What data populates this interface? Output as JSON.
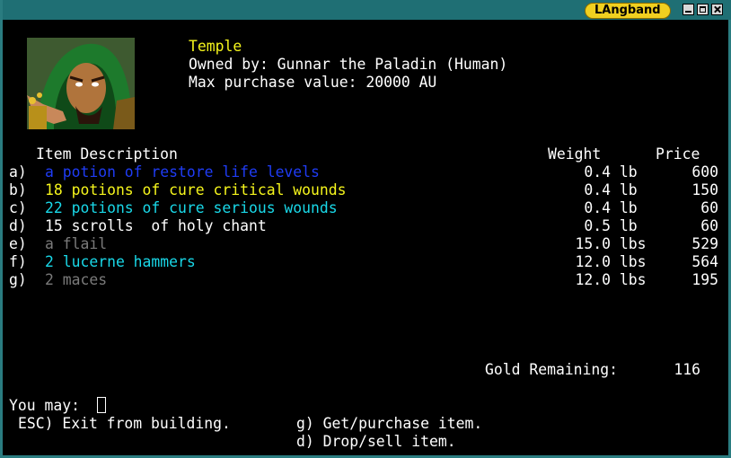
{
  "window": {
    "title": "LAngband"
  },
  "store": {
    "name": "Temple",
    "owner": "Owned by: Gunnar the Paladin (Human)",
    "max_purchase": "Max purchase value: 20000 AU"
  },
  "table": {
    "header_desc": "Item Description",
    "header_weight": "Weight",
    "header_price": "Price",
    "rows": [
      {
        "key": "a)",
        "desc": "a potion of restore life levels",
        "weight": "0.4 lb",
        "price": "600",
        "color": "#1f3cf5"
      },
      {
        "key": "b)",
        "desc": "18 potions of cure critical wounds",
        "weight": "0.4 lb",
        "price": "150",
        "color": "#f5f51c"
      },
      {
        "key": "c)",
        "desc": "22 potions of cure serious wounds",
        "weight": "0.4 lb",
        "price": "60",
        "color": "#19d8e8"
      },
      {
        "key": "d)",
        "desc": "15 scrolls  of holy chant",
        "weight": "0.5 lb",
        "price": "60",
        "color": "#ffffff"
      },
      {
        "key": "e)",
        "desc": "a flail",
        "weight": "15.0 lbs",
        "price": "529",
        "color": "#7a7a7a"
      },
      {
        "key": "f)",
        "desc": "2 lucerne hammers",
        "weight": "12.0 lbs",
        "price": "564",
        "color": "#19d8e8"
      },
      {
        "key": "g)",
        "desc": "2 maces",
        "weight": "12.0 lbs",
        "price": "195",
        "color": "#7a7a7a"
      }
    ]
  },
  "gold": {
    "label": "Gold Remaining:",
    "value": "116"
  },
  "prompt": {
    "you_may": "You may:",
    "esc": "ESC) Exit from building.",
    "purchase": "g) Get/purchase item.",
    "sell": "d) Drop/sell item."
  }
}
